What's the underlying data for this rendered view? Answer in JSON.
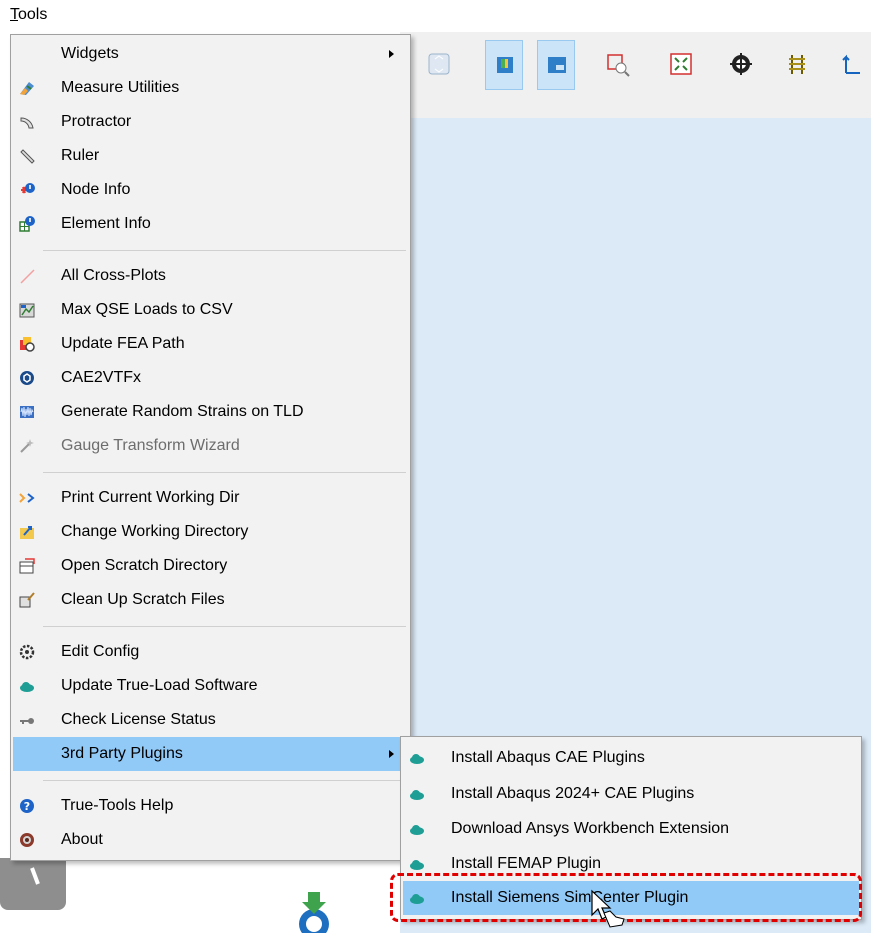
{
  "menubar": {
    "tools_label_u": "T",
    "tools_label_rest": "ools"
  },
  "menu": {
    "items": [
      {
        "label": "Widgets",
        "icon": "none",
        "submenu": true
      },
      {
        "label": "Measure Utilities",
        "icon": "measure-icon"
      },
      {
        "label": "Protractor",
        "icon": "protractor-icon"
      },
      {
        "label": "Ruler",
        "icon": "ruler-icon"
      },
      {
        "label": "Node Info",
        "icon": "node-info-icon"
      },
      {
        "label": "Element Info",
        "icon": "element-info-icon"
      },
      {
        "label": "All Cross-Plots",
        "icon": "cross-plot-icon"
      },
      {
        "label": "Max QSE Loads to CSV",
        "icon": "csv-export-icon"
      },
      {
        "label": "Update FEA Path",
        "icon": "fea-path-icon"
      },
      {
        "label": "CAE2VTFx",
        "icon": "cae2vtfx-icon"
      },
      {
        "label": "Generate Random Strains on TLD",
        "icon": "random-strain-icon"
      },
      {
        "label": "Gauge Transform Wizard",
        "icon": "gauge-wizard-icon",
        "disabled": true
      },
      {
        "label": "Print Current Working Dir",
        "icon": "console-icon"
      },
      {
        "label": "Change Working Directory",
        "icon": "folder-change-icon"
      },
      {
        "label": "Open Scratch Directory",
        "icon": "folder-open-icon"
      },
      {
        "label": "Clean Up Scratch Files",
        "icon": "clean-icon"
      },
      {
        "label": "Edit Config",
        "icon": "gear-icon"
      },
      {
        "label": "Update True-Load Software",
        "icon": "cloud-icon"
      },
      {
        "label": "Check License Status",
        "icon": "key-icon"
      },
      {
        "label": "3rd Party Plugins",
        "icon": "none",
        "submenu": true,
        "highlighted": true
      },
      {
        "label": "True-Tools Help",
        "icon": "help-icon"
      },
      {
        "label": "About",
        "icon": "about-icon"
      }
    ]
  },
  "submenu": {
    "items": [
      {
        "label": "Install Abaqus CAE Plugins",
        "icon": "cloud-icon"
      },
      {
        "label": "Install Abaqus 2024+ CAE Plugins",
        "icon": "cloud-icon"
      },
      {
        "label": "Download Ansys Workbench Extension",
        "icon": "cloud-icon"
      },
      {
        "label": "Install FEMAP Plugin",
        "icon": "cloud-icon"
      },
      {
        "label": "Install Siemens SimCenter Plugin",
        "icon": "cloud-icon",
        "highlighted": true
      }
    ]
  },
  "colors": {
    "highlight": "#91c9f7",
    "annotation": "#e00000",
    "cloud": "#1e9e95"
  }
}
